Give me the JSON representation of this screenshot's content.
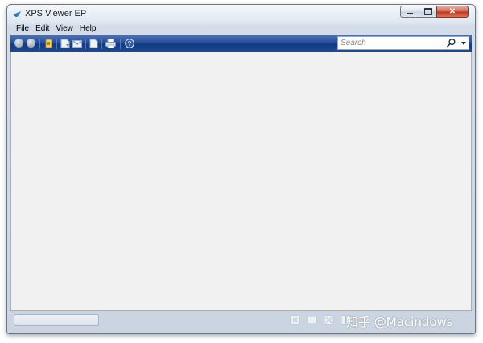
{
  "window": {
    "title": "XPS Viewer EP"
  },
  "menu": {
    "items": [
      {
        "id": "file",
        "label": "File"
      },
      {
        "id": "edit",
        "label": "Edit"
      },
      {
        "id": "view",
        "label": "View"
      },
      {
        "id": "help",
        "label": "Help"
      }
    ]
  },
  "toolbar": {
    "buttons": [
      "back-icon",
      "forward-icon",
      "permissions-icon",
      "save-icon",
      "email-icon",
      "signatures-icon",
      "print-icon",
      "help-icon"
    ],
    "search": {
      "placeholder": "Search"
    }
  },
  "statusbar": {
    "buttons": [
      "fit-page-icon",
      "fit-width-icon",
      "full-screen-icon",
      "two-page-icon"
    ]
  },
  "watermark": "知乎 @Macindows",
  "colors": {
    "toolbar": "#264e98",
    "content": "#f1f1f1",
    "close": "#c0321a"
  }
}
